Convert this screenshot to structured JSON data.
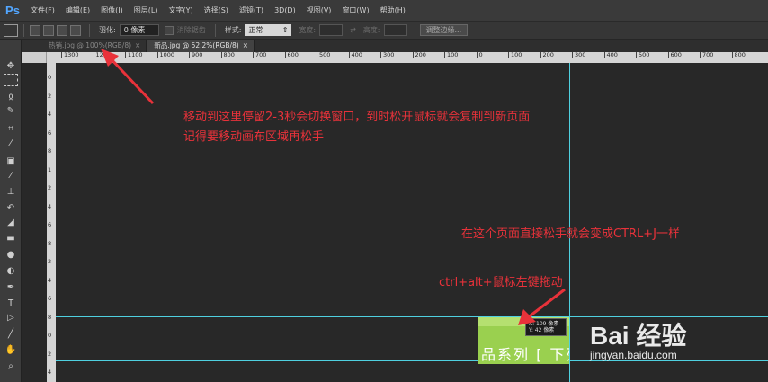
{
  "app": {
    "logo": "Ps"
  },
  "menu": [
    "文件(F)",
    "编辑(E)",
    "图像(I)",
    "图层(L)",
    "文字(Y)",
    "选择(S)",
    "滤镜(T)",
    "3D(D)",
    "视图(V)",
    "窗口(W)",
    "帮助(H)"
  ],
  "options": {
    "feather_label": "羽化:",
    "feather_value": "0 像素",
    "antialias_label": "消除锯齿",
    "style_label": "样式:",
    "style_value": "正常",
    "width_label": "宽度:",
    "height_label": "高度:",
    "refine_button": "调整边缘..."
  },
  "tabs": [
    {
      "label": "热销.jpg @ 100%(RGB/8)",
      "close": "×"
    },
    {
      "label": "新品.jpg @ 52.2%(RGB/8)",
      "close": "×"
    }
  ],
  "ruler_h": [
    "1300",
    "1200",
    "1100",
    "1000",
    "900",
    "800",
    "700",
    "600",
    "500",
    "400",
    "300",
    "200",
    "100",
    "0",
    "100",
    "200",
    "300",
    "400",
    "500",
    "600",
    "700",
    "800"
  ],
  "ruler_v": [
    "0",
    "2",
    "4",
    "6",
    "8",
    "1",
    "2",
    "4",
    "6",
    "8",
    "2",
    "4",
    "6",
    "8",
    "0",
    "2",
    "4"
  ],
  "annotations": {
    "line1": "移动到这里停留2-3秒会切换窗口，到时松开鼠标就会复制到新页面",
    "line2": "记得要移动画布区域再松手",
    "release_here": "在这个页面直接松手就会变成CTRL+J一样",
    "drag_hint": "ctrl+alt+鼠标左键拖动"
  },
  "image": {
    "text": "品系列 [ 下列"
  },
  "tooltip": {
    "line1": "X:  109 像素",
    "line2": "Y:   42 像素"
  },
  "watermark": {
    "logo": "Bai 经验",
    "url": "jingyan.baidu.com"
  },
  "colors": {
    "guide": "#4fd0e0",
    "annotation": "#e8323a",
    "image_green": "#9ad04f",
    "ps_blue": "#52a6ff"
  }
}
